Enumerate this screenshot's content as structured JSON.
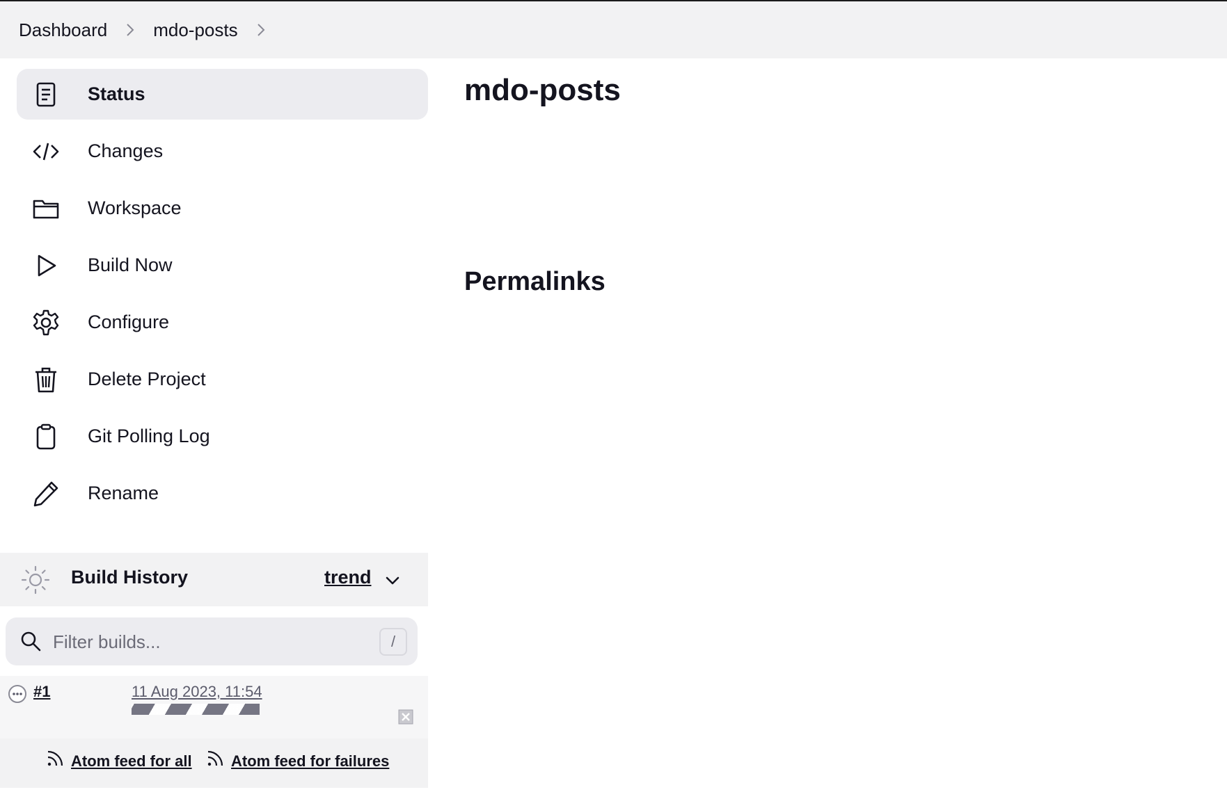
{
  "breadcrumb": {
    "items": [
      "Dashboard",
      "mdo-posts"
    ]
  },
  "sidebar": {
    "items": [
      {
        "label": "Status",
        "icon": "document-icon",
        "active": true
      },
      {
        "label": "Changes",
        "icon": "code-icon",
        "active": false
      },
      {
        "label": "Workspace",
        "icon": "folder-icon",
        "active": false
      },
      {
        "label": "Build Now",
        "icon": "play-icon",
        "active": false
      },
      {
        "label": "Configure",
        "icon": "gear-icon",
        "active": false
      },
      {
        "label": "Delete Project",
        "icon": "trash-icon",
        "active": false
      },
      {
        "label": "Git Polling Log",
        "icon": "clipboard-icon",
        "active": false
      },
      {
        "label": "Rename",
        "icon": "pencil-icon",
        "active": false
      }
    ]
  },
  "main": {
    "title": "mdo-posts",
    "permalinks_heading": "Permalinks"
  },
  "build_history": {
    "title": "Build History",
    "trend_label": "trend",
    "filter_placeholder": "Filter builds...",
    "shortcut_key": "/",
    "builds": [
      {
        "number": "#1",
        "date": "11 Aug 2023, 11:54",
        "status": "in-progress"
      }
    ],
    "feeds": {
      "all_label": "Atom feed for all",
      "failures_label": "Atom feed for failures"
    }
  },
  "colors": {
    "breadcrumb_bg": "#f2f2f3",
    "active_item_bg": "#ececf0",
    "text": "#14141f",
    "muted_text": "#6b6b77"
  }
}
